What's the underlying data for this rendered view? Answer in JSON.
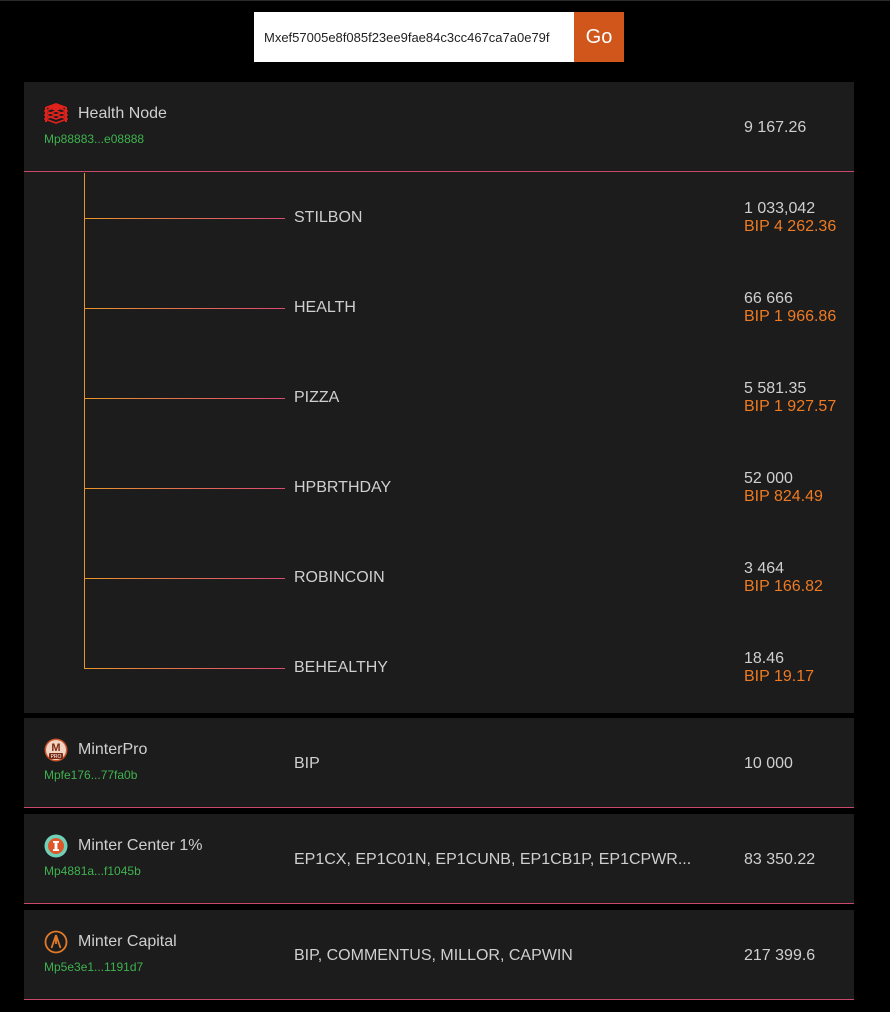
{
  "search": {
    "value": "Mxef57005e8f085f23ee9fae84c3cc467ca7a0e79f",
    "go_label": "Go"
  },
  "validators": [
    {
      "name": "Health Node",
      "address": "Mp88883...e08888",
      "amount": "9 167.26",
      "icon": "health-node-logo-icon",
      "coins": [
        {
          "symbol": "STILBON",
          "amount": "1 033,042",
          "bip": "BIP 4 262.36"
        },
        {
          "symbol": "HEALTH",
          "amount": "66 666",
          "bip": "BIP 1 966.86"
        },
        {
          "symbol": "PIZZA",
          "amount": "5 581.35",
          "bip": "BIP 1 927.57"
        },
        {
          "symbol": "HPBRTHDAY",
          "amount": "52 000",
          "bip": "BIP 824.49"
        },
        {
          "symbol": "ROBINCOIN",
          "amount": "3 464",
          "bip": "BIP 166.82"
        },
        {
          "symbol": "BEHEALTHY",
          "amount": "18.46",
          "bip": "BIP 19.17"
        }
      ]
    },
    {
      "name": "MinterPro",
      "address": "Mpfe176...77fa0b",
      "coins_text": "BIP",
      "amount": "10 000",
      "icon": "minterpro-logo-icon"
    },
    {
      "name": "Minter Center 1%",
      "address": "Mp4881a...f1045b",
      "coins_text": "EP1CX, EP1C01N, EP1CUNB, EP1CB1P, EP1CPWR...",
      "amount": "83 350.22",
      "icon": "minter-center-logo-icon"
    },
    {
      "name": "Minter Capital",
      "address": "Mp5e3e1...1191d7",
      "coins_text": "BIP, COMMENTUS, MILLOR, CAPWIN",
      "amount": "217 399.6",
      "icon": "minter-capital-logo-icon"
    }
  ],
  "colors": {
    "background": "#000000",
    "card": "#1c1c1c",
    "accent": "#d0561b",
    "address": "#3fb24f",
    "bip": "#ef7a22",
    "divider": "#c8496a"
  }
}
